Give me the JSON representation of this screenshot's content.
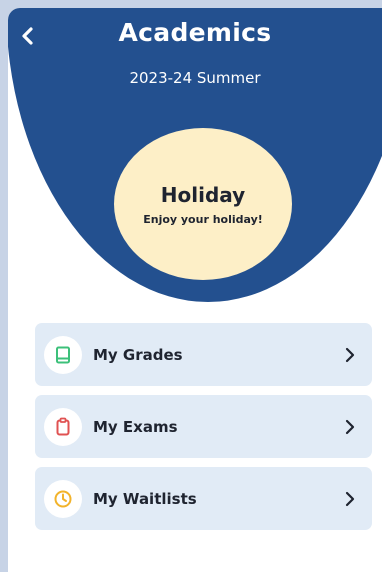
{
  "header": {
    "title": "Academics",
    "term": "2023-24 Summer",
    "back_icon": "chevron-left-icon"
  },
  "status": {
    "title": "Holiday",
    "message": "Enjoy your holiday!"
  },
  "menu": {
    "items": [
      {
        "label": "My Grades",
        "icon": "book-icon",
        "icon_color": "#3cc07a"
      },
      {
        "label": "My Exams",
        "icon": "clipboard-icon",
        "icon_color": "#e05252"
      },
      {
        "label": "My Waitlists",
        "icon": "clock-icon",
        "icon_color": "#f2b32b"
      }
    ]
  },
  "colors": {
    "header_bg": "#23508f",
    "status_bg": "#fdefc7",
    "menu_item_bg": "#e1ebf6",
    "page_bg": "#c7d3e6"
  }
}
